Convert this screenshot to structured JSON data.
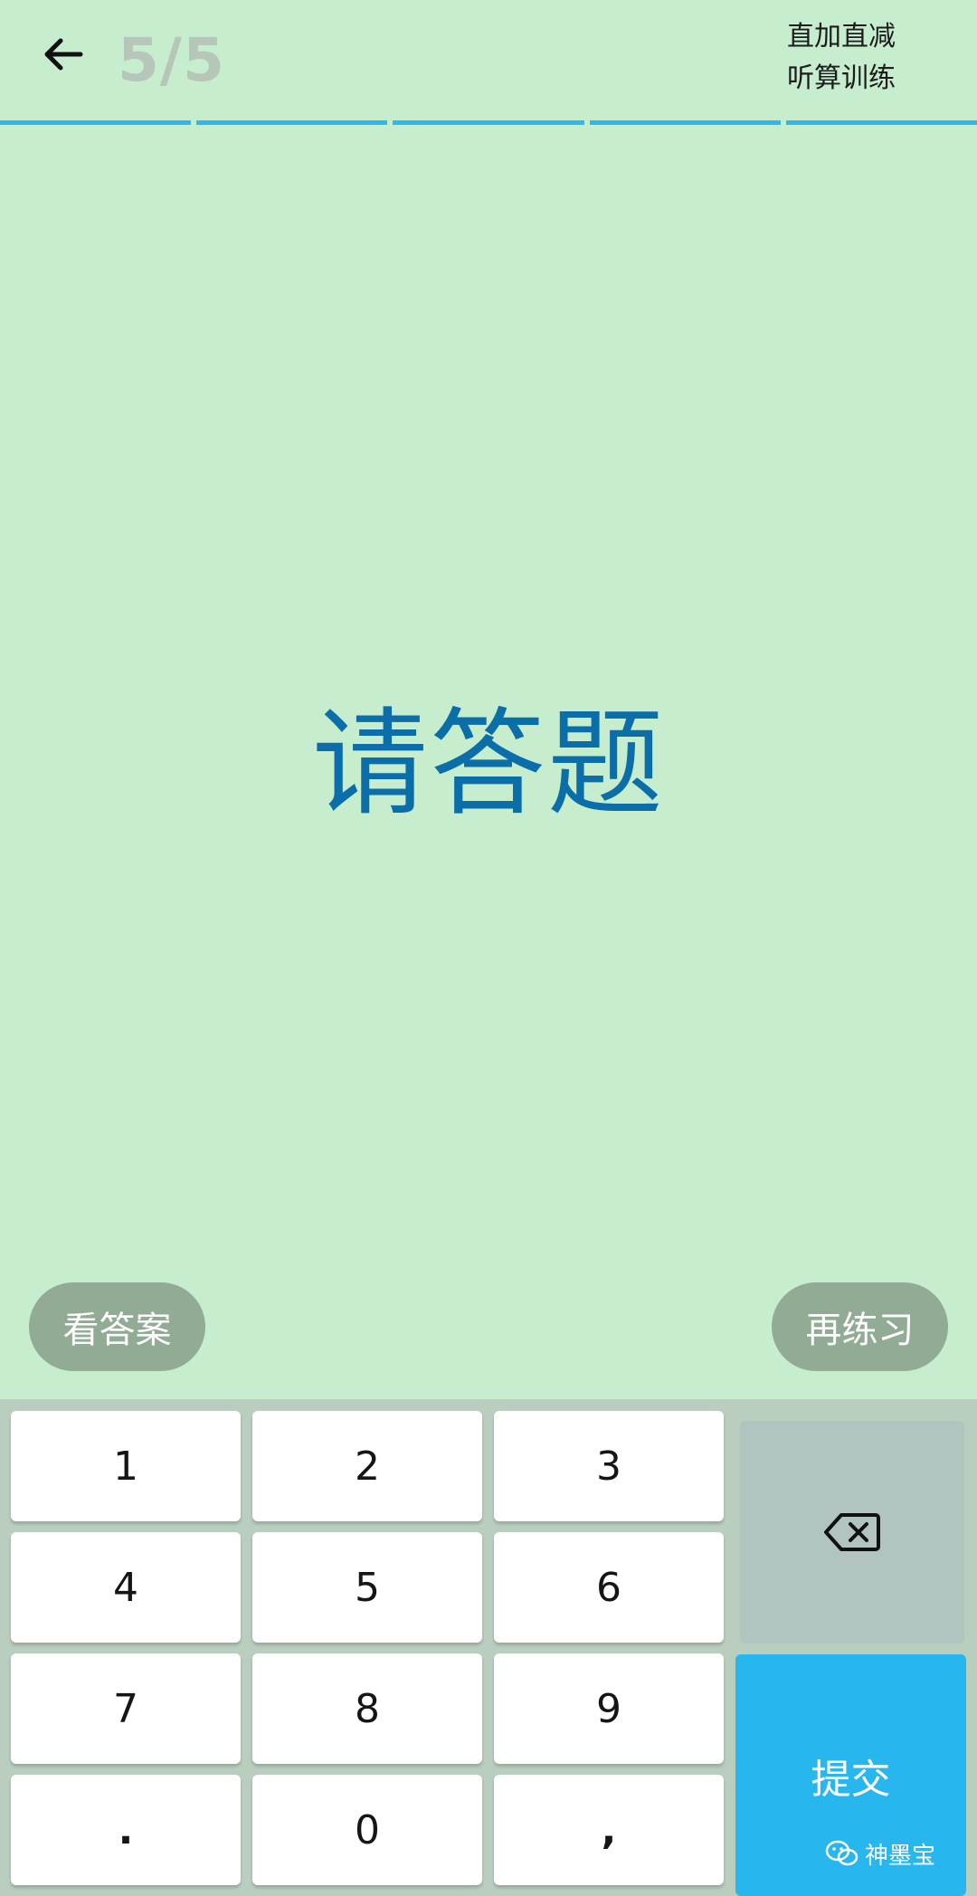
{
  "header": {
    "progress": "5/5",
    "mode_line1": "直加直减",
    "mode_line2": "听算训练",
    "segments_total": 5,
    "segments_completed": 5
  },
  "main": {
    "prompt": "请答题"
  },
  "actions": {
    "show_answer": "看答案",
    "practice_again": "再练习"
  },
  "keyboard": {
    "keys": [
      "1",
      "2",
      "3",
      "4",
      "5",
      "6",
      "7",
      "8",
      "9",
      ".",
      "0",
      ","
    ],
    "submit": "提交"
  },
  "watermark": {
    "text": "神墨宝"
  },
  "colors": {
    "background": "#c7edcf",
    "accent": "#2fb7ee",
    "prompt": "#0b6ea8",
    "pill": "#92ab94"
  }
}
